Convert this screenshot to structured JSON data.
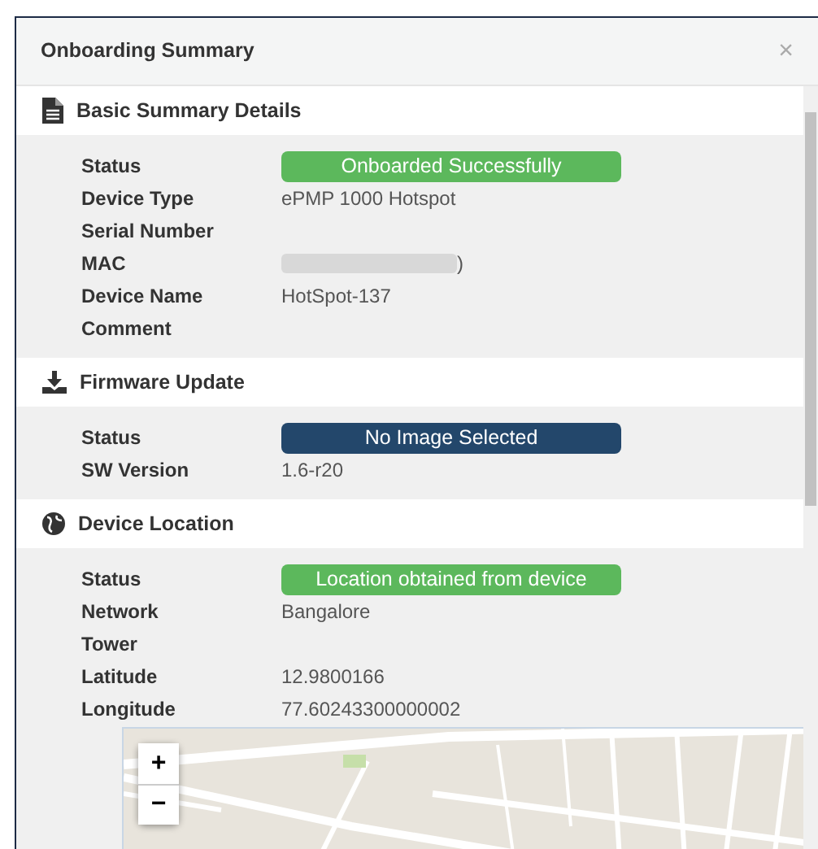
{
  "dialog": {
    "title": "Onboarding Summary",
    "close": "×"
  },
  "sections": [
    {
      "title": "Basic Summary Details",
      "rows": [
        {
          "label": "Status",
          "kind": "badge",
          "value": "Onboarded Successfully",
          "color": "#5cb85c"
        },
        {
          "label": "Device Type",
          "kind": "text",
          "value": "ePMP 1000 Hotspot"
        },
        {
          "label": "Serial Number",
          "kind": "text"
        },
        {
          "label": "MAC",
          "kind": "redacted",
          "value": ")"
        },
        {
          "label": "Device Name",
          "kind": "text",
          "value": "HotSpot-137"
        },
        {
          "label": "Comment",
          "kind": "text"
        }
      ]
    },
    {
      "title": "Firmware Update",
      "rows": [
        {
          "label": "Status",
          "kind": "badge",
          "value": "No Image Selected",
          "color": "#23476b"
        },
        {
          "label": "SW Version",
          "kind": "text",
          "value": "1.6-r20"
        }
      ]
    },
    {
      "title": "Device Location",
      "rows": [
        {
          "label": "Status",
          "kind": "badge",
          "value": "Location obtained from device",
          "color": "#5cb85c"
        },
        {
          "label": "Network",
          "kind": "text",
          "value": "Bangalore"
        },
        {
          "label": "Tower",
          "kind": "text"
        },
        {
          "label": "Latitude",
          "kind": "text",
          "value": "12.9800166"
        },
        {
          "label": "Longitude",
          "kind": "text",
          "value": "77.60243300000002"
        }
      ],
      "map": {
        "kind": "picture",
        "zoom_in": "+",
        "zoom_out": "−"
      }
    }
  ]
}
